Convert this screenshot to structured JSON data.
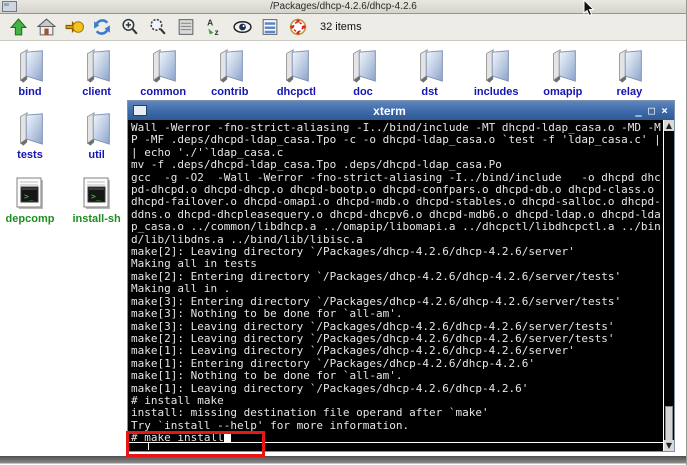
{
  "colors": {
    "titlebar_blue": "#3a67a8",
    "folder_label": "#1414b4",
    "script_label": "#1e8f1e",
    "annotation_red": "#e81717"
  },
  "window": {
    "title": "/Packages/dhcp-4.2.6/dhcp-4.2.6"
  },
  "toolbar": {
    "items_label": "32 items",
    "icons": [
      {
        "name": "up-icon"
      },
      {
        "name": "home-icon"
      },
      {
        "name": "go-icon"
      },
      {
        "name": "refresh-icon"
      },
      {
        "name": "zoom-in-icon"
      },
      {
        "name": "zoom-out-icon"
      },
      {
        "name": "list-view-icon"
      },
      {
        "name": "sort-az-icon"
      },
      {
        "name": "show-hidden-eye-icon"
      },
      {
        "name": "details-view-icon"
      },
      {
        "name": "select-all-icon"
      }
    ]
  },
  "icons": {
    "folders_row1": [
      "bind",
      "client",
      "common",
      "contrib",
      "dhcpctl",
      "doc",
      "dst",
      "includes",
      "omapip",
      "relay",
      ""
    ],
    "folders_row2": [
      "tests",
      "util"
    ],
    "scripts": [
      "depcomp",
      "install-sh"
    ]
  },
  "xterm": {
    "title": "xterm",
    "buttons": {
      "minimize": "_",
      "maximize": "□",
      "close": "×"
    },
    "scrollbar": {
      "up": "▲",
      "down": "▼"
    },
    "cursor_line": 25,
    "lines": [
      "Wall -Werror -fno-strict-aliasing -I../bind/include -MT dhcpd-ldap_casa.o -MD -M",
      "P -MF .deps/dhcpd-ldap_casa.Tpo -c -o dhcpd-ldap_casa.o `test -f 'ldap_casa.c' |",
      "| echo './'`ldap_casa.c",
      "mv -f .deps/dhcpd-ldap_casa.Tpo .deps/dhcpd-ldap_casa.Po",
      "gcc  -g -O2  -Wall -Werror -fno-strict-aliasing -I../bind/include   -o dhcpd dhc",
      "pd-dhcpd.o dhcpd-dhcp.o dhcpd-bootp.o dhcpd-confpars.o dhcpd-db.o dhcpd-class.o ",
      "dhcpd-failover.o dhcpd-omapi.o dhcpd-mdb.o dhcpd-stables.o dhcpd-salloc.o dhcpd-",
      "ddns.o dhcpd-dhcpleasequery.o dhcpd-dhcpv6.o dhcpd-mdb6.o dhcpd-ldap.o dhcpd-lda",
      "p_casa.o ../common/libdhcp.a ../omapip/libomapi.a ../dhcpctl/libdhcpctl.a ../bin",
      "d/lib/libdns.a ../bind/lib/libisc.a",
      "make[2]: Leaving directory `/Packages/dhcp-4.2.6/dhcp-4.2.6/server'",
      "Making all in tests",
      "make[2]: Entering directory `/Packages/dhcp-4.2.6/dhcp-4.2.6/server/tests'",
      "Making all in .",
      "make[3]: Entering directory `/Packages/dhcp-4.2.6/dhcp-4.2.6/server/tests'",
      "make[3]: Nothing to be done for `all-am'.",
      "make[3]: Leaving directory `/Packages/dhcp-4.2.6/dhcp-4.2.6/server/tests'",
      "make[2]: Leaving directory `/Packages/dhcp-4.2.6/dhcp-4.2.6/server/tests'",
      "make[1]: Leaving directory `/Packages/dhcp-4.2.6/dhcp-4.2.6/server'",
      "make[1]: Entering directory `/Packages/dhcp-4.2.6/dhcp-4.2.6'",
      "make[1]: Nothing to be done for `all-am'.",
      "make[1]: Leaving directory `/Packages/dhcp-4.2.6/dhcp-4.2.6'",
      "# install make",
      "install: missing destination file operand after `make'",
      "Try `install --help' for more information.",
      "# make install"
    ]
  }
}
